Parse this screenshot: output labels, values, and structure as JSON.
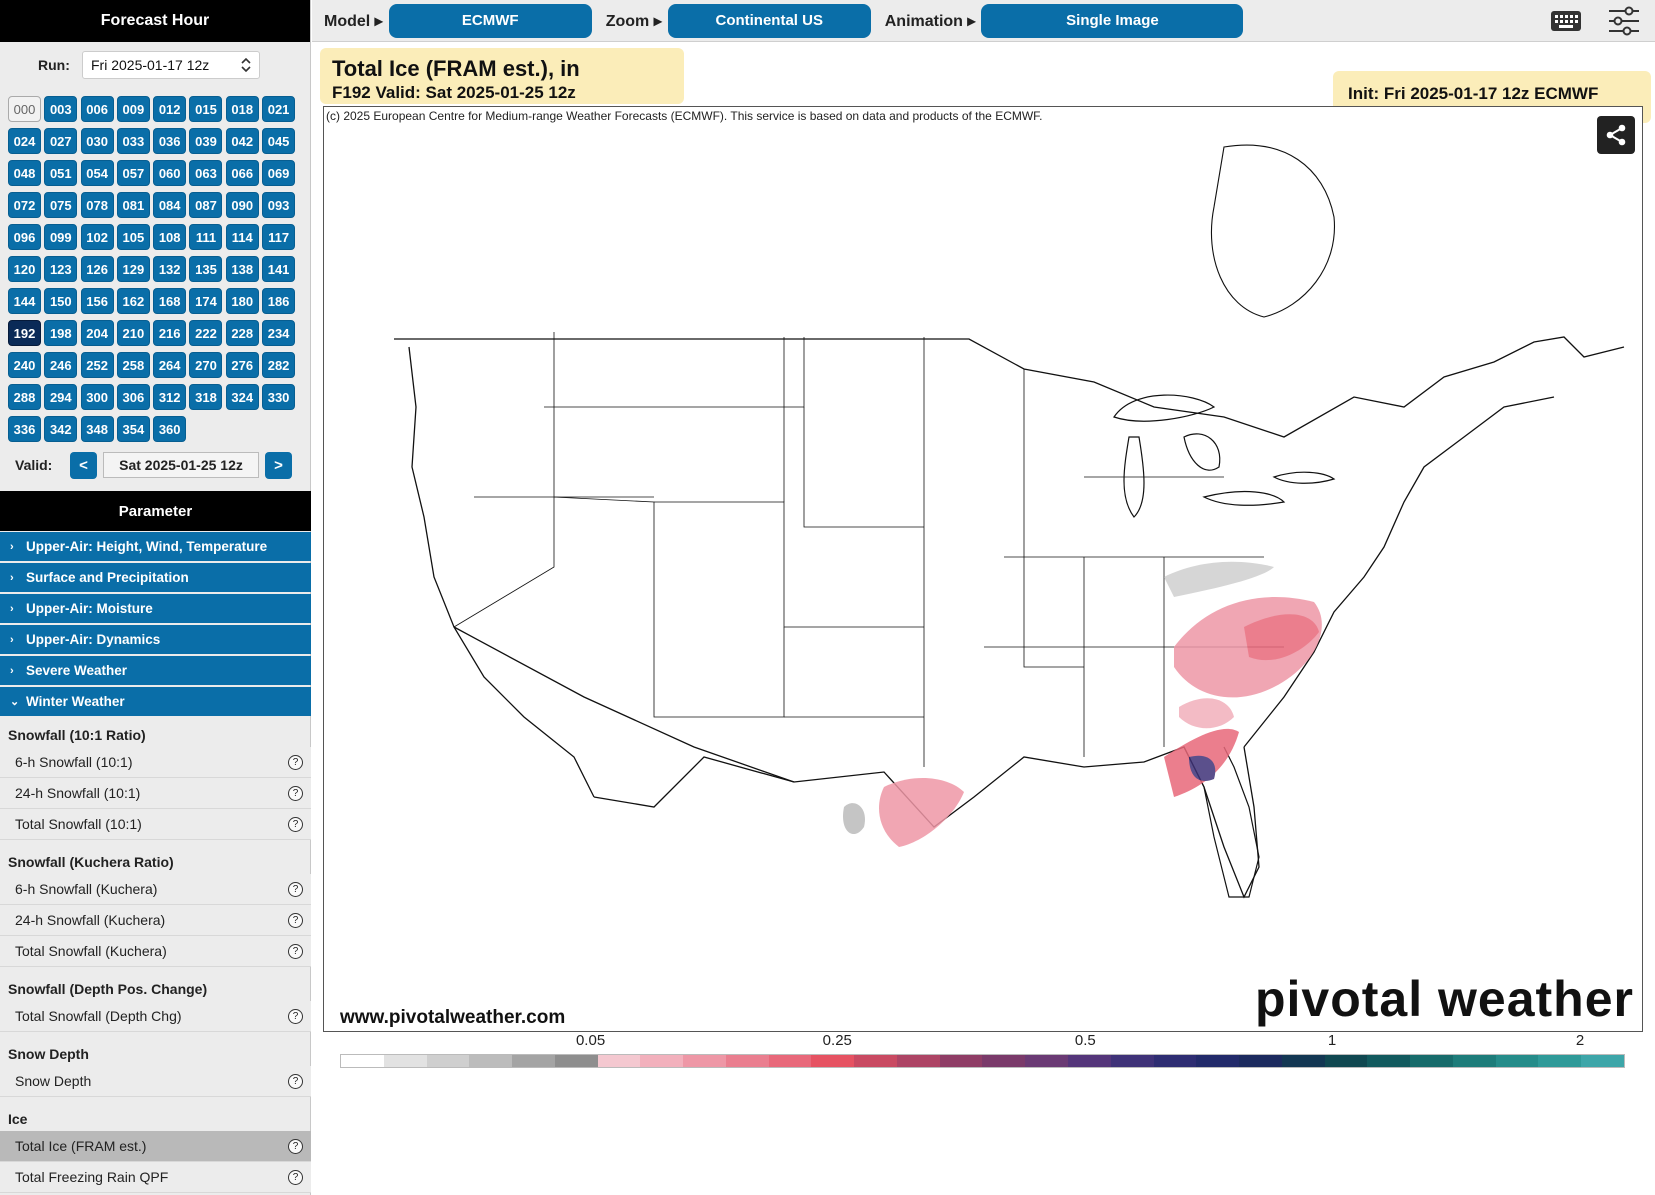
{
  "sidebar": {
    "forecast_hour_title": "Forecast Hour",
    "run_label": "Run:",
    "run_value": "Fri 2025-01-17 12z",
    "hours": [
      "000",
      "003",
      "006",
      "009",
      "012",
      "015",
      "018",
      "021",
      "024",
      "027",
      "030",
      "033",
      "036",
      "039",
      "042",
      "045",
      "048",
      "051",
      "054",
      "057",
      "060",
      "063",
      "066",
      "069",
      "072",
      "075",
      "078",
      "081",
      "084",
      "087",
      "090",
      "093",
      "096",
      "099",
      "102",
      "105",
      "108",
      "111",
      "114",
      "117",
      "120",
      "123",
      "126",
      "129",
      "132",
      "135",
      "138",
      "141",
      "144",
      "150",
      "156",
      "162",
      "168",
      "174",
      "180",
      "186",
      "192",
      "198",
      "204",
      "210",
      "216",
      "222",
      "228",
      "234",
      "240",
      "246",
      "252",
      "258",
      "264",
      "270",
      "276",
      "282",
      "288",
      "294",
      "300",
      "306",
      "312",
      "318",
      "324",
      "330",
      "336",
      "342",
      "348",
      "354",
      "360"
    ],
    "selected_hour": "192",
    "valid_label": "Valid:",
    "valid_value": "Sat 2025-01-25 12z",
    "prev_label": "<",
    "next_label": ">",
    "parameter_title": "Parameter",
    "categories": [
      {
        "label": "Upper-Air: Height, Wind, Temperature",
        "expanded": false
      },
      {
        "label": "Surface and Precipitation",
        "expanded": false
      },
      {
        "label": "Upper-Air: Moisture",
        "expanded": false
      },
      {
        "label": "Upper-Air: Dynamics",
        "expanded": false
      },
      {
        "label": "Severe Weather",
        "expanded": false
      },
      {
        "label": "Winter Weather",
        "expanded": true
      }
    ],
    "groups": [
      {
        "title": "Snowfall (10:1 Ratio)",
        "items": [
          "6-h Snowfall (10:1)",
          "24-h Snowfall (10:1)",
          "Total Snowfall (10:1)"
        ]
      },
      {
        "title": "Snowfall (Kuchera Ratio)",
        "items": [
          "6-h Snowfall (Kuchera)",
          "24-h Snowfall (Kuchera)",
          "Total Snowfall (Kuchera)"
        ]
      },
      {
        "title": "Snowfall (Depth Pos. Change)",
        "items": [
          "Total Snowfall (Depth Chg)"
        ]
      },
      {
        "title": "Snow Depth",
        "items": [
          "Snow Depth"
        ]
      },
      {
        "title": "Ice",
        "items": [
          "Total Ice (FRAM est.)",
          "Total Freezing Rain QPF"
        ]
      }
    ],
    "selected_param": "Total Ice (FRAM est.)",
    "help_glyph": "?"
  },
  "topbar": {
    "model_label": "Model ▸",
    "model_value": "ECMWF",
    "zoom_label": "Zoom ▸",
    "zoom_value": "Continental US",
    "animation_label": "Animation ▸",
    "animation_value": "Single Image",
    "keyboard_icon": "keyboard-icon",
    "settings_icon": "sliders-icon"
  },
  "map": {
    "title": "Total Ice (FRAM est.), in",
    "subtitle": "F192 Valid: Sat 2025-01-25 12z",
    "init": "Init: Fri 2025-01-17 12z ECMWF",
    "copyright": "(c) 2025 European Centre for Medium-range Weather Forecasts (ECMWF). This service is based on data and products of the ECMWF.",
    "site": "www.pivotalweather.com",
    "brand": "pivotal weather",
    "share_icon": "share-icon"
  },
  "scale": {
    "ticks": [
      "0.05",
      "0.25",
      "0.5",
      "1",
      "2"
    ],
    "colors": [
      "#ffffff",
      "#e2e2e2",
      "#cfcfcf",
      "#bcbcbc",
      "#a4a4a4",
      "#8e8e8e",
      "#f4c8d0",
      "#f2b0bc",
      "#ee97a6",
      "#ea7e8f",
      "#e8687a",
      "#e65262",
      "#c94a62",
      "#ad4465",
      "#8f3d66",
      "#7a3a6a",
      "#6a3a74",
      "#54357a",
      "#3f3278",
      "#2e2d72",
      "#222a6a",
      "#1c2a5e",
      "#133753",
      "#104851",
      "#125a5e",
      "#176b6b",
      "#1d7c7a",
      "#258c8a",
      "#2f9a99",
      "#3da6a9"
    ]
  }
}
